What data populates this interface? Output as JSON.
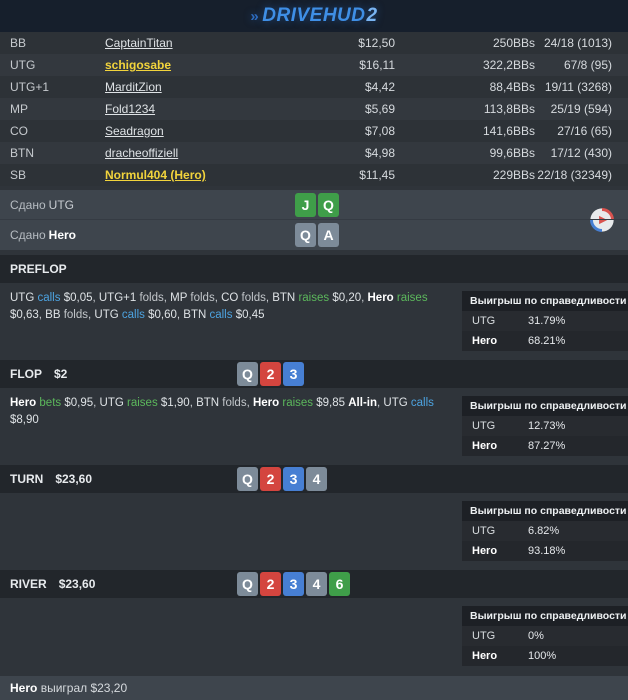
{
  "header": {
    "logo_text": "DRIVEHUD",
    "logo_suffix": "2"
  },
  "players": {
    "rows": [
      {
        "position": "BB",
        "name": "CaptainTitan",
        "stack": "$12,50",
        "bbs": "250BBs",
        "stats": "24/18 (1013)",
        "highlight": false
      },
      {
        "position": "UTG",
        "name": "schigosabe",
        "stack": "$16,11",
        "bbs": "322,2BBs",
        "stats": "67/8 (95)",
        "highlight": true
      },
      {
        "position": "UTG+1",
        "name": "MarditZion",
        "stack": "$4,42",
        "bbs": "88,4BBs",
        "stats": "19/11 (3268)",
        "highlight": false
      },
      {
        "position": "MP",
        "name": "Fold1234",
        "stack": "$5,69",
        "bbs": "113,8BBs",
        "stats": "25/19 (594)",
        "highlight": false
      },
      {
        "position": "CO",
        "name": "Seadragon",
        "stack": "$7,08",
        "bbs": "141,6BBs",
        "stats": "27/16 (65)",
        "highlight": false
      },
      {
        "position": "BTN",
        "name": "dracheoffiziell",
        "stack": "$4,98",
        "bbs": "99,6BBs",
        "stats": "17/12 (430)",
        "highlight": false
      },
      {
        "position": "SB",
        "name": "Normul404 (Hero)",
        "stack": "$11,45",
        "bbs": "229BBs",
        "stats": "22/18 (32349)",
        "highlight": true
      }
    ]
  },
  "dealt": {
    "rows": [
      {
        "label_prefix": "Сдано",
        "label_target": "UTG",
        "target_bold": false,
        "cards": [
          {
            "rank": "J",
            "suit": "green"
          },
          {
            "rank": "Q",
            "suit": "green"
          }
        ]
      },
      {
        "label_prefix": "Сдано",
        "label_target": "Hero",
        "target_bold": true,
        "cards": [
          {
            "rank": "Q",
            "suit": "gray"
          },
          {
            "rank": "A",
            "suit": "gray"
          }
        ]
      }
    ]
  },
  "streets": [
    {
      "title": "PREFLOP",
      "pot": "",
      "cards": [],
      "actions": [
        {
          "player": "UTG",
          "verb": "calls",
          "amount": "$0,05"
        },
        {
          "player": "UTG+1",
          "verb": "folds"
        },
        {
          "player": "MP",
          "verb": "folds"
        },
        {
          "player": "CO",
          "verb": "folds"
        },
        {
          "player": "BTN",
          "verb": "raises",
          "amount": "$0,20"
        },
        {
          "player": "Hero",
          "verb": "raises",
          "amount": "$0,63",
          "hero": true
        },
        {
          "player": "BB",
          "verb": "folds"
        },
        {
          "player": "UTG",
          "verb": "calls",
          "amount": "$0,60"
        },
        {
          "player": "BTN",
          "verb": "calls",
          "amount": "$0,45"
        }
      ],
      "equity": {
        "title": "Выигрыш по справедливости",
        "rows": [
          {
            "name": "UTG",
            "value": "31.79%"
          },
          {
            "name": "Hero",
            "value": "68.21%"
          }
        ]
      }
    },
    {
      "title": "FLOP",
      "pot": "$2",
      "cards": [
        {
          "rank": "Q",
          "suit": "gray"
        },
        {
          "rank": "2",
          "suit": "red"
        },
        {
          "rank": "3",
          "suit": "blue"
        }
      ],
      "actions": [
        {
          "player": "Hero",
          "verb": "bets",
          "amount": "$0,95",
          "hero": true
        },
        {
          "player": "UTG",
          "verb": "raises",
          "amount": "$1,90"
        },
        {
          "player": "BTN",
          "verb": "folds"
        },
        {
          "player": "Hero",
          "verb": "raises",
          "amount": "$9,85",
          "suffix": "All-in",
          "hero": true
        },
        {
          "player": "UTG",
          "verb": "calls",
          "amount": "$8,90"
        }
      ],
      "equity": {
        "title": "Выигрыш по справедливости",
        "rows": [
          {
            "name": "UTG",
            "value": "12.73%"
          },
          {
            "name": "Hero",
            "value": "87.27%"
          }
        ]
      }
    },
    {
      "title": "TURN",
      "pot": "$23,60",
      "cards": [
        {
          "rank": "Q",
          "suit": "gray"
        },
        {
          "rank": "2",
          "suit": "red"
        },
        {
          "rank": "3",
          "suit": "blue"
        },
        {
          "rank": "4",
          "suit": "gray"
        }
      ],
      "actions": [],
      "equity": {
        "title": "Выигрыш по справедливости",
        "rows": [
          {
            "name": "UTG",
            "value": "6.82%"
          },
          {
            "name": "Hero",
            "value": "93.18%"
          }
        ]
      }
    },
    {
      "title": "RIVER",
      "pot": "$23,60",
      "cards": [
        {
          "rank": "Q",
          "suit": "gray"
        },
        {
          "rank": "2",
          "suit": "red"
        },
        {
          "rank": "3",
          "suit": "blue"
        },
        {
          "rank": "4",
          "suit": "gray"
        },
        {
          "rank": "6",
          "suit": "green"
        }
      ],
      "actions": [],
      "equity": {
        "title": "Выигрыш по справедливости",
        "rows": [
          {
            "name": "UTG",
            "value": "0%"
          },
          {
            "name": "Hero",
            "value": "100%"
          }
        ]
      }
    }
  ],
  "footer": {
    "winner": "Hero",
    "text": "выиграл $23,20"
  }
}
